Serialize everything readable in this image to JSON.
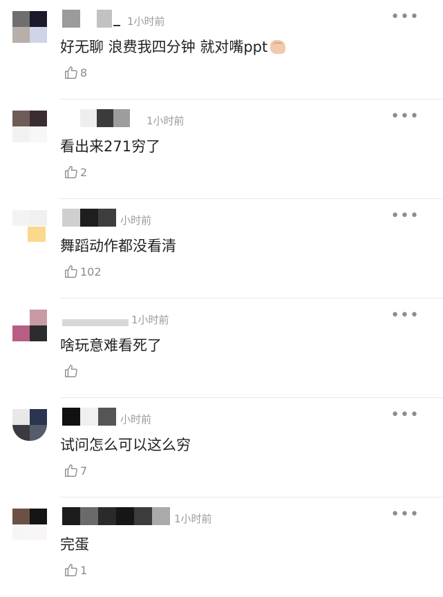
{
  "comments": [
    {
      "time": "1小时前",
      "text": "好无聊 浪费我四分钟 就对嘴ppt",
      "emoji": "fist-icon",
      "likes": "8"
    },
    {
      "time": "1小时前",
      "text": "看出来271穷了",
      "likes": "2"
    },
    {
      "time": "小时前",
      "text": "舞蹈动作都没看清",
      "likes": "102"
    },
    {
      "time": "1小时前",
      "text": "啥玩意难看死了",
      "likes": ""
    },
    {
      "time": "小时前",
      "text": "试问怎么可以这么穷",
      "likes": "7"
    },
    {
      "time": "1小时前",
      "text": "完蛋",
      "likes": "1"
    }
  ],
  "icons": {
    "more": "more-dots-icon",
    "like": "thumbs-up-icon"
  },
  "colors": {
    "text": "#222222",
    "muted": "#9a9a9a",
    "divider": "#e8e8e8"
  }
}
